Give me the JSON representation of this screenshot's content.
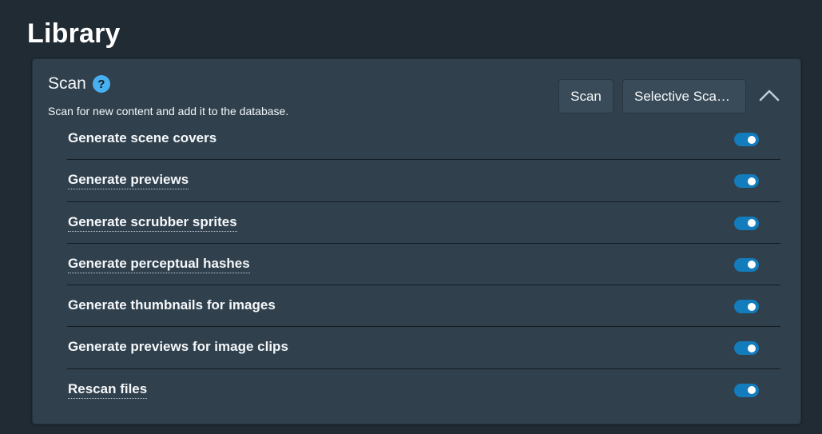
{
  "page": {
    "title": "Library"
  },
  "scan": {
    "title": "Scan",
    "help_icon": "?",
    "subtitle": "Scan for new content and add it to the database.",
    "scan_button": "Scan",
    "selective_scan_button": "Selective Scan…",
    "collapse_icon": "chevron-up-icon"
  },
  "options": [
    {
      "label": "Generate scene covers",
      "tooltip": false,
      "enabled": true
    },
    {
      "label": "Generate previews",
      "tooltip": true,
      "enabled": true
    },
    {
      "label": "Generate scrubber sprites",
      "tooltip": true,
      "enabled": true
    },
    {
      "label": "Generate perceptual hashes",
      "tooltip": true,
      "enabled": true
    },
    {
      "label": "Generate thumbnails for images",
      "tooltip": false,
      "enabled": true
    },
    {
      "label": "Generate previews for image clips",
      "tooltip": false,
      "enabled": true
    },
    {
      "label": "Rescan files",
      "tooltip": true,
      "enabled": true
    }
  ],
  "colors": {
    "background": "#202b33",
    "card": "#30404d",
    "accent": "#137cbd",
    "help": "#48aff0"
  }
}
